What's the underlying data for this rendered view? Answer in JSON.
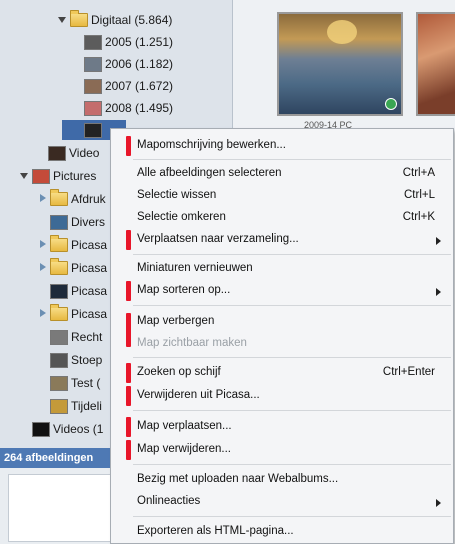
{
  "tree": {
    "items": [
      {
        "label": "Digitaal (5.864)",
        "type": "folder",
        "expand": "open"
      },
      {
        "label": "2005 (1.251)",
        "type": "thumb",
        "color": "#5c5c5c"
      },
      {
        "label": "2006 (1.182)",
        "type": "thumb",
        "color": "#6e7a88"
      },
      {
        "label": "2007 (1.672)",
        "type": "thumb",
        "color": "#8a6b55"
      },
      {
        "label": "2008 (1.495)",
        "type": "thumb",
        "color": "#c46d6d"
      },
      {
        "label": "",
        "type": "thumb",
        "color": "#222222"
      },
      {
        "label": "Video",
        "type": "thumb",
        "color": "#3a2a22"
      },
      {
        "label": "Pictures",
        "type": "thumb",
        "color": "#c44b3a",
        "expand": "open"
      },
      {
        "label": "Afdruk",
        "type": "folder",
        "expand": "closed"
      },
      {
        "label": "Divers",
        "type": "thumb",
        "color": "#3d6a96"
      },
      {
        "label": "Picasa",
        "type": "folder",
        "expand": "closed"
      },
      {
        "label": "Picasa",
        "type": "folder",
        "expand": "closed"
      },
      {
        "label": "Picasa",
        "type": "thumb",
        "color": "#1d2a3a"
      },
      {
        "label": "Picasa",
        "type": "folder",
        "expand": "closed"
      },
      {
        "label": "Recht",
        "type": "thumb",
        "color": "#7a7a7a"
      },
      {
        "label": "Stoep",
        "type": "thumb",
        "color": "#555555"
      },
      {
        "label": "Test (",
        "type": "thumb",
        "color": "#8a7a5a"
      },
      {
        "label": "Tijdeli",
        "type": "thumb",
        "color": "#c49a3a"
      },
      {
        "label": "Videos (1",
        "type": "thumb",
        "color": "#111111"
      }
    ]
  },
  "status": {
    "text": "264 afbeeldingen"
  },
  "gallery": {
    "caption": "2009-14 PC"
  },
  "menu": {
    "items": [
      {
        "label": "Mapomschrijving bewerken...",
        "shortcut": "",
        "submenu": false,
        "disabled": false
      },
      {
        "label": "Alle afbeeldingen selecteren",
        "shortcut": "Ctrl+A",
        "submenu": false,
        "disabled": false
      },
      {
        "label": "Selectie wissen",
        "shortcut": "Ctrl+L",
        "submenu": false,
        "disabled": false
      },
      {
        "label": "Selectie omkeren",
        "shortcut": "Ctrl+K",
        "submenu": false,
        "disabled": false
      },
      {
        "label": "Verplaatsen naar verzameling...",
        "shortcut": "",
        "submenu": true,
        "disabled": false
      },
      {
        "label": "Miniaturen vernieuwen",
        "shortcut": "",
        "submenu": false,
        "disabled": false
      },
      {
        "label": "Map sorteren op...",
        "shortcut": "",
        "submenu": true,
        "disabled": false
      },
      {
        "label": "Map verbergen",
        "shortcut": "",
        "submenu": false,
        "disabled": false
      },
      {
        "label": "Map zichtbaar maken",
        "shortcut": "",
        "submenu": false,
        "disabled": true
      },
      {
        "label": "Zoeken op schijf",
        "shortcut": "Ctrl+Enter",
        "submenu": false,
        "disabled": false
      },
      {
        "label": "Verwijderen uit Picasa...",
        "shortcut": "",
        "submenu": false,
        "disabled": false
      },
      {
        "label": "Map verplaatsen...",
        "shortcut": "",
        "submenu": false,
        "disabled": false
      },
      {
        "label": "Map verwijderen...",
        "shortcut": "",
        "submenu": false,
        "disabled": false
      },
      {
        "label": "Bezig met uploaden naar Webalbums...",
        "shortcut": "",
        "submenu": false,
        "disabled": false
      },
      {
        "label": "Onlineacties",
        "shortcut": "",
        "submenu": true,
        "disabled": false
      },
      {
        "label": "Exporteren als HTML-pagina...",
        "shortcut": "",
        "submenu": false,
        "disabled": false
      }
    ]
  },
  "colors": {
    "highlight_marker": "#e8162a",
    "selection": "#3f6aa8",
    "status_bar": "#4e79b4"
  }
}
